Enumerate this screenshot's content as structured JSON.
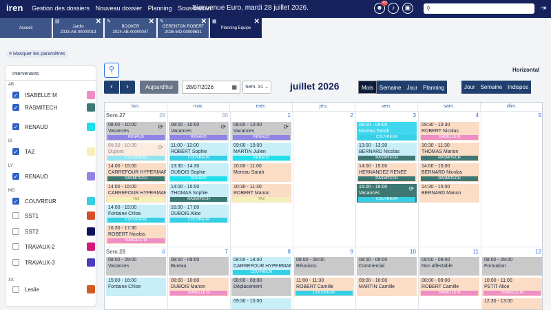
{
  "app": {
    "logo": "iren",
    "welcome": "Bienvenue Euro, mardi 28 juillet 2026."
  },
  "nav": [
    "Gestion des dossiers",
    "Nouveau dossier",
    "Planning",
    "Sous-traitan"
  ],
  "header_icons": {
    "notif_badge": "49",
    "icons": [
      "user-badge-icon",
      "bell-icon",
      "package-icon",
      "logout-icon"
    ]
  },
  "search": {
    "placeholder": "",
    "icon": "search-icon"
  },
  "tabs": [
    {
      "l1": "Accueil",
      "l2": ""
    },
    {
      "l1": "Jardin",
      "l2": "2023-AB-00000013"
    },
    {
      "l1": "BOOKER",
      "l2": "2024-AB-00000047"
    },
    {
      "l1": "GERENTON ROBERT",
      "l2": "2026-MO-00009631"
    },
    {
      "l1": "Planning Equipe",
      "l2": ""
    }
  ],
  "sidebar": {
    "hide_label": "Masquer les paramètres",
    "title": "Intervenants",
    "groups": [
      "AB",
      "IS",
      "LY",
      "MO",
      "XX"
    ],
    "resources": [
      {
        "label": "ISABELLE M",
        "checked": true,
        "color": "#ee8ec5"
      },
      {
        "label": "RASMITECH",
        "checked": true,
        "color": "#3e7873"
      },
      {
        "label": "RENAUD",
        "checked": true,
        "color": "#1fe0ea"
      },
      {
        "label": "TAZ",
        "checked": true,
        "color": "#f3f0b8"
      },
      {
        "label": "RENAUD",
        "checked": true,
        "color": "#8f83e6"
      },
      {
        "label": "COUVREUR",
        "checked": true,
        "color": "#36d0e6"
      },
      {
        "label": "SST1",
        "checked": false,
        "color": "#d34f2a"
      },
      {
        "label": "SST2",
        "checked": false,
        "color": "#101060"
      },
      {
        "label": "TRAVAUX-2",
        "checked": false,
        "color": "#d21a7a"
      },
      {
        "label": "TRAVAUX-3",
        "checked": false,
        "color": "#4a3ec0"
      },
      {
        "label": "Leslie",
        "checked": false,
        "color": "#d25a25"
      }
    ]
  },
  "toolbar": {
    "prev": "‹",
    "next": "›",
    "today": "Aujourd'hui",
    "date": "28/07/2026",
    "week": "Sem. 31",
    "month_title": "juillet 2026",
    "view_horizontal": "Horizontal",
    "views1": [
      "Mois",
      "Semaine",
      "Jour",
      "Planning"
    ],
    "views2": [
      "Jour",
      "Semaine",
      "Indispos"
    ]
  },
  "calendar": {
    "days": [
      "lun.",
      "mar.",
      "mer.",
      "jeu.",
      "ven.",
      "sam.",
      "dim."
    ],
    "week1_label": "Sem.27",
    "week1_dates": [
      "29",
      "30",
      "1",
      "2",
      "3",
      "4",
      "5"
    ],
    "week2_label": "Sem.28",
    "week2_dates": [
      "6",
      "7",
      "8",
      "9",
      "10",
      "11",
      "12"
    ],
    "events": [
      {
        "d": 0,
        "row": 0,
        "time": "08:00 - 10:00",
        "name": "Vacances",
        "res": "RENAUD",
        "bg": "#c9c9c9",
        "rc": "#8f83e6",
        "sync": true
      },
      {
        "d": 0,
        "row": 1,
        "time": "09:30 - 10:30",
        "name": "Dupont",
        "res": "COUVREUR",
        "bg": "#fbdcc5",
        "rc": "#36d0e6",
        "sync": true,
        "faded": true
      },
      {
        "d": 0,
        "row": 2,
        "time": "14:00 - 15:00",
        "name": "CARREFOUR HYPERMARCH",
        "res": "RASMITECH",
        "bg": "#fbdcc5",
        "rc": "#3e7873"
      },
      {
        "d": 0,
        "row": 3,
        "time": "14:00 - 15:00",
        "name": "CARREFOUR HYPERMARCH",
        "res": "TAZ",
        "bg": "#fbdcc5",
        "rc": "#f3f0b8"
      },
      {
        "d": 0,
        "row": 4,
        "time": "14:00 - 15:00",
        "name": "Fontaine Chloe",
        "res": "COUVREUR",
        "bg": "#c8eef7",
        "rc": "#36d0e6"
      },
      {
        "d": 0,
        "row": 5,
        "time": "16:30 - 17:30",
        "name": "ROBERT Nicolas",
        "res": "ISABELLE M",
        "bg": "#fbdcc5",
        "rc": "#ee8ec5"
      },
      {
        "d": 1,
        "row": 0,
        "time": "08:00 - 10:00",
        "name": "Vacances",
        "res": "RENAUD",
        "bg": "#c9c9c9",
        "rc": "#8f83e6",
        "sync": true
      },
      {
        "d": 1,
        "row": 1,
        "time": "11:00 - 12:00",
        "name": "ROBERT Sophie",
        "res": "COUVREUR",
        "bg": "#c8eef7",
        "rc": "#36d0e6"
      },
      {
        "d": 1,
        "row": 2,
        "time": "13:30 - 14:30",
        "name": "DUBOIS Sophie",
        "res": "RENAUD",
        "bg": "#c8eef7",
        "rc": "#1fe0ea"
      },
      {
        "d": 1,
        "row": 3,
        "time": "14:00 - 15:00",
        "name": "THOMAS Sophie",
        "res": "RASMITECH",
        "bg": "#c8eef7",
        "rc": "#3e7873"
      },
      {
        "d": 1,
        "row": 4,
        "time": "16:00 - 17:00",
        "name": "DUBOIS Alice",
        "res": "COUVREUR",
        "bg": "#c8eef7",
        "rc": "#36d0e6"
      },
      {
        "d": 2,
        "row": 0,
        "time": "08:00 - 10:00",
        "name": "Vacances",
        "res": "RENAUD",
        "bg": "#c9c9c9",
        "rc": "#8f83e6",
        "sync": true
      },
      {
        "d": 2,
        "row": 1,
        "time": "09:00 - 10:00",
        "name": "MARTIN Julien",
        "res": "RENAUD",
        "bg": "#c8eef7",
        "rc": "#1fe0ea"
      },
      {
        "d": 2,
        "row": 2,
        "time": "10:00 - 11:00",
        "name": "Moreau Sarah",
        "res": "",
        "bg": "#fbdcc5",
        "rc": ""
      },
      {
        "d": 2,
        "row": 3,
        "time": "10:30 - 11:30",
        "name": "ROBERT Manon",
        "res": "TAZ",
        "bg": "#fbdcc5",
        "rc": "#f3f0b8"
      },
      {
        "d": 4,
        "row": 0,
        "time": "08:00 - 09:00",
        "name": "Moreau Sarah",
        "res": "COUVREUR",
        "bg": "#3fd6ee",
        "rc": "#36d0e6",
        "white": true
      },
      {
        "d": 4,
        "row": 1,
        "time": "13:00 - 13:30",
        "name": "BERNARD Nicolas",
        "res": "RASMITECH",
        "bg": "#c8eef7",
        "rc": "#3e7873"
      },
      {
        "d": 4,
        "row": 2,
        "time": "14:00 - 15:00",
        "name": "HERNANDEZ RENEE",
        "res": "RASMITECH",
        "bg": "#fbdcc5",
        "rc": "#3e7873"
      },
      {
        "d": 4,
        "row": 3,
        "time": "15:00 - 16:00",
        "name": "Vacances",
        "res": "COUVREUR",
        "bg": "#3e7873",
        "rc": "#36d0e6",
        "white": true,
        "sync": true
      },
      {
        "d": 5,
        "row": 0,
        "time": "09:30 - 10:30",
        "name": "ROBERT Nicolas",
        "res": "ISABELLE M",
        "bg": "#fbdcc5",
        "rc": "#ee8ec5"
      },
      {
        "d": 5,
        "row": 1,
        "time": "10:30 - 11:30",
        "name": "THOMAS Manon",
        "res": "RASMITECH",
        "bg": "#fbdcc5",
        "rc": "#3e7873"
      },
      {
        "d": 5,
        "row": 2,
        "time": "14:00 - 15:00",
        "name": "BERNARD Nicolas",
        "res": "RASMITECH",
        "bg": "#fbdcc5",
        "rc": "#3e7873"
      },
      {
        "d": 5,
        "row": 3,
        "time": "14:30 - 15:00",
        "name": "BERNARD Manon",
        "res": "",
        "bg": "#fbdcc5",
        "rc": ""
      },
      {
        "d": 0,
        "row": 6,
        "time": "08:00 - 09:00",
        "name": "Vacances",
        "res": "",
        "bg": "#c9c9c9",
        "rc": ""
      },
      {
        "d": 0,
        "row": 7,
        "time": "15:00 - 16:00",
        "name": "Fontaine Chloe",
        "res": "",
        "bg": "#c8eef7",
        "rc": ""
      },
      {
        "d": 1,
        "row": 6,
        "time": "08:00 - 09:00",
        "name": "Bureau",
        "res": "",
        "bg": "#c9c9c9",
        "rc": ""
      },
      {
        "d": 1,
        "row": 7,
        "time": "08:00 - 10:00",
        "name": "DUBOIS Manon",
        "res": "ISABELLE M",
        "bg": "#fbdcc5",
        "rc": "#ee8ec5"
      },
      {
        "d": 2,
        "row": 6,
        "time": "08:00 - 18:00",
        "name": "CARREFOUR HYPERMARCH",
        "res": "COUVREUR",
        "bg": "#c8eef7",
        "rc": "#36d0e6"
      },
      {
        "d": 2,
        "row": 7,
        "time": "08:00 - 09:00",
        "name": "Déplacement",
        "res": "",
        "bg": "#c9c9c9",
        "rc": ""
      },
      {
        "d": 2,
        "row": 8,
        "time": "09:30 - 10:00",
        "name": "",
        "res": "",
        "bg": "#c8eef7",
        "rc": ""
      },
      {
        "d": 3,
        "row": 6,
        "time": "08:00 - 09:00",
        "name": "Réunions",
        "res": "",
        "bg": "#c9c9c9",
        "rc": ""
      },
      {
        "d": 3,
        "row": 7,
        "time": "11:00 - 11:30",
        "name": "ROBERT Camille",
        "res": "COUVREUR",
        "bg": "#fbdcc5",
        "rc": "#36d0e6"
      },
      {
        "d": 4,
        "row": 6,
        "time": "08:00 - 09:00",
        "name": "Commercial",
        "res": "",
        "bg": "#c9c9c9",
        "rc": ""
      },
      {
        "d": 4,
        "row": 7,
        "time": "09:00 - 10:00",
        "name": "MARTIN Camille",
        "res": "",
        "bg": "#fbdcc5",
        "rc": ""
      },
      {
        "d": 5,
        "row": 6,
        "time": "08:00 - 09:00",
        "name": "Non affectable",
        "res": "",
        "bg": "#c9c9c9",
        "rc": ""
      },
      {
        "d": 5,
        "row": 7,
        "time": "08:00 - 09:00",
        "name": "ROBERT Camille",
        "res": "ISABELLE M",
        "bg": "#fbdcc5",
        "rc": "#ee8ec5"
      },
      {
        "d": 6,
        "row": 6,
        "time": "08:00 - 09:00",
        "name": "Formation",
        "res": "",
        "bg": "#c9c9c9",
        "rc": ""
      },
      {
        "d": 6,
        "row": 7,
        "time": "10:00 - 11:00",
        "name": "PETIT Alice",
        "res": "ISABELLE M",
        "bg": "#fbdcc5",
        "rc": "#ee8ec5"
      },
      {
        "d": 6,
        "row": 8,
        "time": "12:30 - 13:00",
        "name": "",
        "res": "",
        "bg": "#fbdcc5",
        "rc": ""
      }
    ]
  }
}
